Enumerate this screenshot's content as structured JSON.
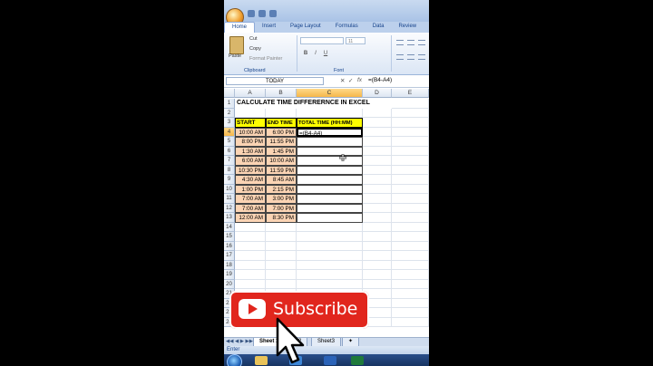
{
  "titlebar": {
    "qat_icons": [
      "save-icon",
      "undo-icon",
      "redo-icon"
    ]
  },
  "tabs": [
    "Home",
    "Insert",
    "Page Layout",
    "Formulas",
    "Data",
    "Review"
  ],
  "active_tab": "Home",
  "clipboard": {
    "paste": "Paste",
    "cut": "Cut",
    "copy": "Copy",
    "format_painter": "Format Painter",
    "label": "Clipboard"
  },
  "font_group": {
    "font_size": "11",
    "bold": "B",
    "italic": "I",
    "underline": "U",
    "label": "Font"
  },
  "formula_bar": {
    "name_box": "TODAY",
    "formula": "=(B4-A4)"
  },
  "columns": [
    "A",
    "B",
    "C",
    "D",
    "E"
  ],
  "selected_column": "C",
  "selected_row": "4",
  "rows": [
    "1",
    "2",
    "3",
    "4",
    "5",
    "6",
    "7",
    "8",
    "9",
    "10",
    "11",
    "12",
    "13",
    "14",
    "15",
    "16",
    "17",
    "18",
    "19",
    "20",
    "21",
    "22",
    "23",
    "24"
  ],
  "sheet": {
    "title": "CALCULATE TIME DIFFERERNCE IN EXCEL",
    "headers": [
      "START",
      "END TIME",
      "TOTAL TIME (HH:MM)"
    ],
    "data": [
      {
        "start": "10:00 AM",
        "end": "6:00 PM",
        "total": "=(B4-A4)"
      },
      {
        "start": "8:00 PM",
        "end": "11:55 PM",
        "total": ""
      },
      {
        "start": "1:30 AM",
        "end": "1:45 PM",
        "total": ""
      },
      {
        "start": "6:00 AM",
        "end": "10:00 AM",
        "total": ""
      },
      {
        "start": "10:30 PM",
        "end": "11:59 PM",
        "total": ""
      },
      {
        "start": "4:30 AM",
        "end": "8:45 AM",
        "total": ""
      },
      {
        "start": "1:00 PM",
        "end": "2:15 PM",
        "total": ""
      },
      {
        "start": "7:00 AM",
        "end": "3:00 PM",
        "total": ""
      },
      {
        "start": "7:00 AM",
        "end": "7:00 PM",
        "total": ""
      },
      {
        "start": "12:00 AM",
        "end": "8:30 PM",
        "total": ""
      }
    ]
  },
  "sheet_tabs": [
    "Sheet 1",
    "et2",
    "Sheet3"
  ],
  "status": "Enter",
  "subscribe": {
    "label": "Subscribe"
  }
}
